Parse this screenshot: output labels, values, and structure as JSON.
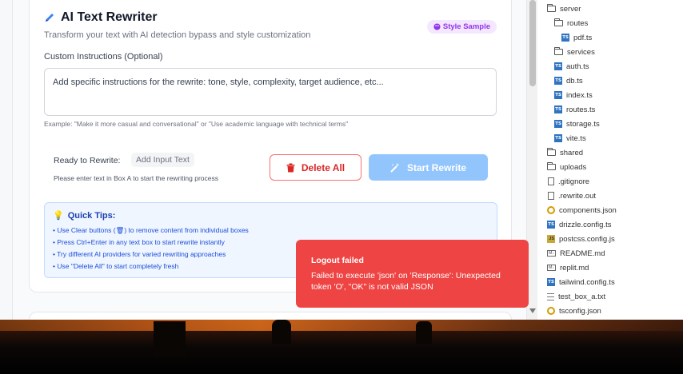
{
  "app": {
    "title": "AI Text Rewriter",
    "subtitle": "Transform your text with AI detection bypass and style customization",
    "style_badge": "Style Sample",
    "custom_label": "Custom Instructions (Optional)",
    "custom_placeholder": "Add specific instructions for the rewrite: tone, style, complexity, target audience, etc...",
    "example": "Example: \"Make it more casual and conversational\" or \"Use academic language with technical terms\"",
    "ready_label": "Ready to Rewrite:",
    "ready_value": "Add Input Text",
    "ready_hint": "Please enter text in Box A to start the rewriting process",
    "delete_label": "Delete All",
    "rewrite_label": "Start Rewrite",
    "tips_title": "Quick Tips:",
    "tips": [
      "• Use Clear buttons (🗑) to remove content from individual boxes",
      "• Press Ctrl+Enter in any text box to start rewrite instantly",
      "• Try different AI providers for varied rewriting approaches",
      "• Use \"Delete All\" to start completely fresh"
    ]
  },
  "file_tree": {
    "items": [
      {
        "name": "server",
        "icon": "folder-icon"
      },
      {
        "name": "routes",
        "icon": "folder-icon"
      },
      {
        "name": "pdf.ts",
        "icon": "typescript-file-icon"
      },
      {
        "name": "services",
        "icon": "folder-icon"
      },
      {
        "name": "auth.ts",
        "icon": "typescript-file-icon"
      },
      {
        "name": "db.ts",
        "icon": "typescript-file-icon"
      },
      {
        "name": "index.ts",
        "icon": "typescript-file-icon"
      },
      {
        "name": "routes.ts",
        "icon": "typescript-file-icon"
      },
      {
        "name": "storage.ts",
        "icon": "typescript-file-icon"
      },
      {
        "name": "vite.ts",
        "icon": "typescript-file-icon"
      },
      {
        "name": "shared",
        "icon": "folder-icon"
      },
      {
        "name": "uploads",
        "icon": "folder-icon"
      },
      {
        "name": ".gitignore",
        "icon": "file-icon"
      },
      {
        "name": ".rewrite.out",
        "icon": "file-icon"
      },
      {
        "name": "components.json",
        "icon": "json-file-icon"
      },
      {
        "name": "drizzle.config.ts",
        "icon": "typescript-file-icon"
      },
      {
        "name": "postcss.config.js",
        "icon": "javascript-file-icon"
      },
      {
        "name": "README.md",
        "icon": "markdown-file-icon"
      },
      {
        "name": "replit.md",
        "icon": "markdown-file-icon"
      },
      {
        "name": "tailwind.config.ts",
        "icon": "typescript-file-icon"
      },
      {
        "name": "test_box_a.txt",
        "icon": "text-file-icon"
      },
      {
        "name": "tsconfig.json",
        "icon": "json-file-icon"
      }
    ]
  },
  "toast": {
    "title": "Logout failed",
    "message": "Failed to execute 'json' on 'Response': Unexpected token 'O', \"OK\" is not valid JSON"
  },
  "colors": {
    "accent_blue": "#93c5fd",
    "danger_red": "#dc2626",
    "toast_red": "#ef4444",
    "badge_purple": "#9333ea"
  }
}
